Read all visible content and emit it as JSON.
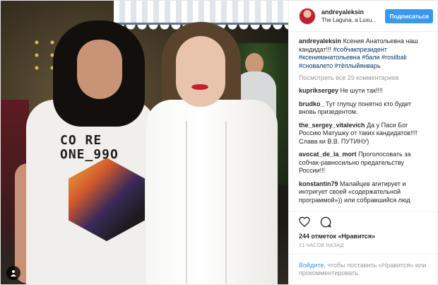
{
  "photo": {
    "shirt_text_1": "CO RE",
    "shirt_text_2": "ONE_99O"
  },
  "header": {
    "username": "andreyaleksin",
    "location": "The Laguna, a Luxu...",
    "follow_label": "Подписаться"
  },
  "caption": {
    "username": "andreyaleksin",
    "text": "Ксения Анатольевна наш кандидат!!!",
    "hashtags": "#собчакпрезидент #ксенияанатольевна #бали #rosilbali #сновалето #тёплыйянварь"
  },
  "view_all": "Посмотреть все 29 комментариев",
  "comments": [
    {
      "user": "kupriksergey",
      "text": "Не шути так!!!!"
    },
    {
      "user": "brudko_",
      "text": "Тут глупцу понятно кто будет вновь призедентом."
    },
    {
      "user": "the_sergey_vitalevich",
      "text": "Да у Паси Бог Россию Матушку от таких кандидатов!!!! Слава ки В.В. ПУТИНУ)"
    },
    {
      "user": "avocat_de_la_mort",
      "text": "Проголосовать за собчак-равносильно предательству России!!!"
    },
    {
      "user": "konstantin79",
      "text": "Малайцев агитирует и интригует своей «содержательной программой»)) или собравшийся люд"
    }
  ],
  "likes": "244 отметок «Нравится»",
  "timestamp": "21 ЧАСОВ НАЗАД",
  "login": {
    "link": "Войдите",
    "rest": ", чтобы поставить «Нравится» или прокомментировать."
  },
  "icons": {
    "like": "heart-icon",
    "comment": "comment-icon",
    "tag": "user-tag-icon"
  },
  "colors": {
    "accent": "#3897f0",
    "hashtag": "#003569",
    "muted": "#999999"
  }
}
